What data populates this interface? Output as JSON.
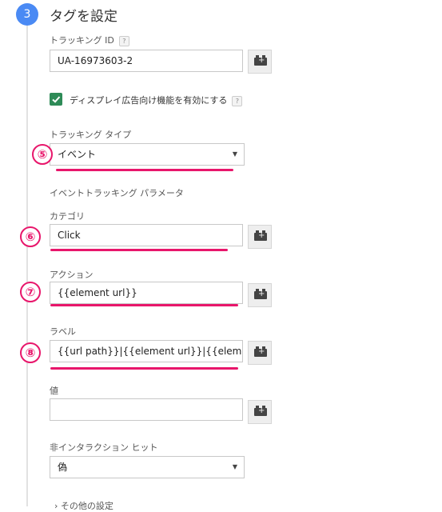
{
  "step": {
    "number": "3",
    "title": "タグを設定"
  },
  "tracking_id": {
    "label": "トラッキング ID",
    "help": "?",
    "value": "UA-16973603-2"
  },
  "display_features": {
    "label": "ディスプレイ広告向け機能を有効にする",
    "help": "?",
    "checked": true
  },
  "tracking_type": {
    "label": "トラッキング タイプ",
    "value": "イベント",
    "annotation": "⑤"
  },
  "event_params_heading": "イベントトラッキング パラメータ",
  "category": {
    "label": "カテゴリ",
    "value": "Click",
    "annotation": "⑥"
  },
  "action": {
    "label": "アクション",
    "value": "{{element url}}",
    "annotation": "⑦"
  },
  "label_field": {
    "label": "ラベル",
    "value": "{{url path}}|{{element url}}|{{element text}}",
    "annotation": "⑧"
  },
  "value_field": {
    "label": "値",
    "value": ""
  },
  "non_interaction": {
    "label": "非インタラクション ヒット",
    "value": "偽"
  },
  "more_settings": {
    "label": "その他の設定",
    "chevron": "›"
  },
  "colors": {
    "accent": "#4a8af4",
    "annotation": "#e8166b",
    "checkbox": "#2e8b57"
  },
  "icons": [
    "variable-picker-icon",
    "dropdown-arrow-icon",
    "check-icon",
    "chevron-right-icon"
  ]
}
